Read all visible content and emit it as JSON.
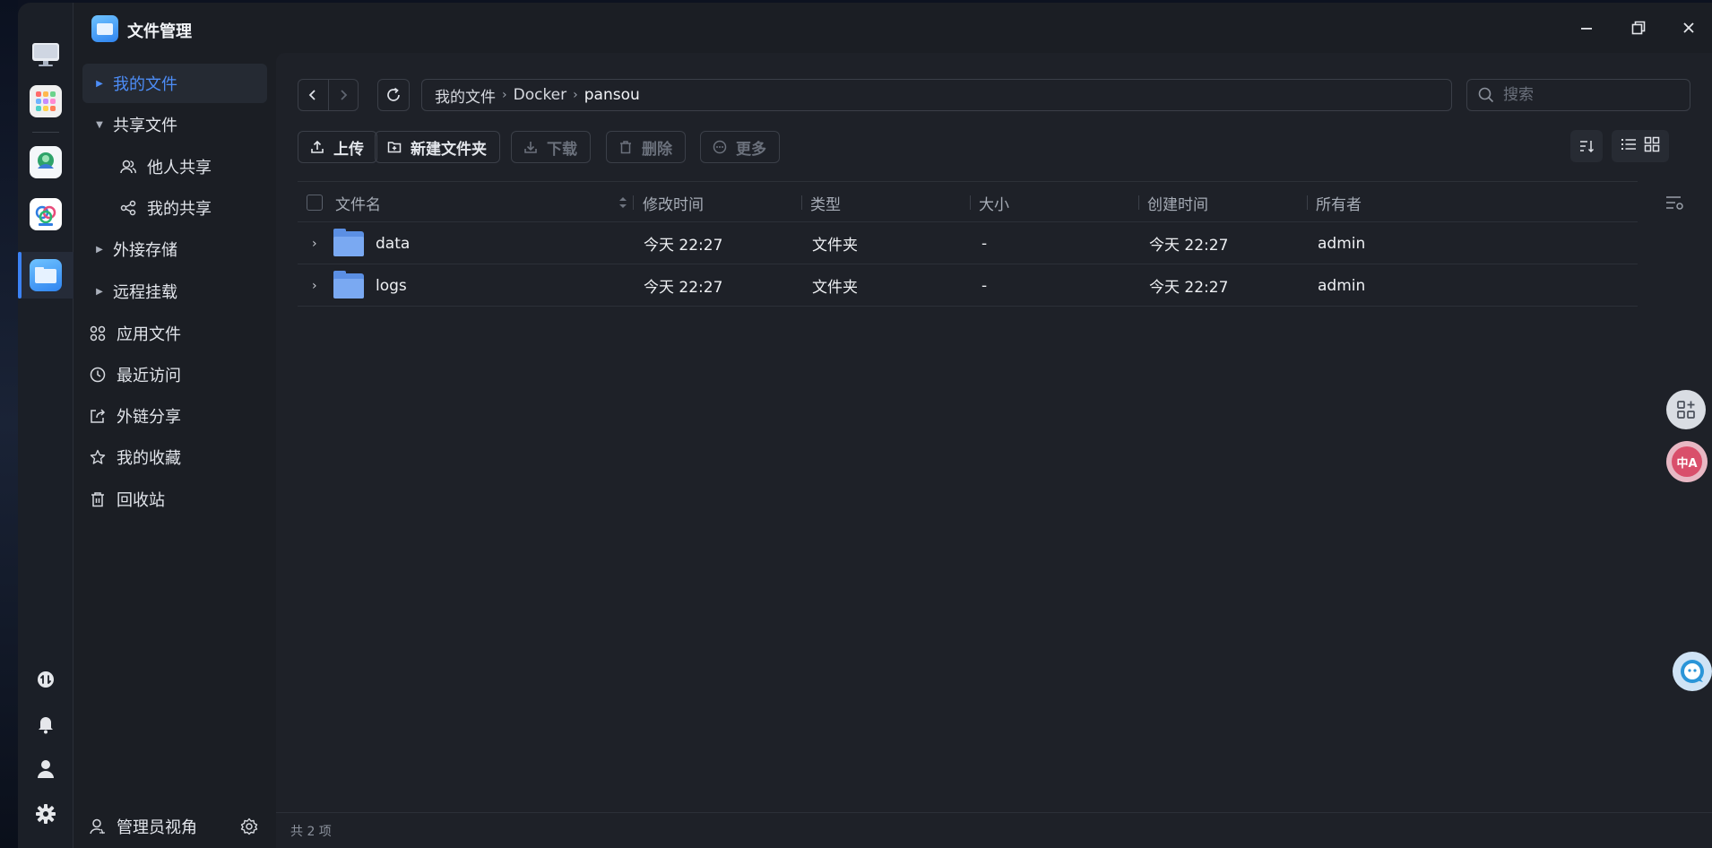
{
  "app": {
    "title": "文件管理"
  },
  "window_controls": {
    "minimize_icon": "minimize-icon",
    "maximize_icon": "maximize-icon",
    "close_icon": "close-icon"
  },
  "sidebar": {
    "items": [
      {
        "label": "我的文件",
        "icon": "caret-right",
        "active": true
      },
      {
        "label": "共享文件",
        "icon": "caret-down"
      },
      {
        "label": "他人共享",
        "icon": "users-icon"
      },
      {
        "label": "我的共享",
        "icon": "share-icon"
      },
      {
        "label": "外接存储",
        "icon": "caret-right"
      },
      {
        "label": "远程挂载",
        "icon": "caret-right"
      },
      {
        "label": "应用文件",
        "icon": "apps-icon"
      },
      {
        "label": "最近访问",
        "icon": "clock-icon"
      },
      {
        "label": "外链分享",
        "icon": "external-share-icon"
      },
      {
        "label": "我的收藏",
        "icon": "star-icon"
      },
      {
        "label": "回收站",
        "icon": "trash-icon"
      }
    ],
    "footer_label": "管理员视角"
  },
  "breadcrumb": {
    "items": [
      "我的文件",
      "Docker",
      "pansou"
    ]
  },
  "search": {
    "placeholder": "搜索"
  },
  "toolbar": {
    "upload": "上传",
    "new_folder": "新建文件夹",
    "download": "下载",
    "delete": "删除",
    "more": "更多"
  },
  "table": {
    "headers": [
      "文件名",
      "修改时间",
      "类型",
      "大小",
      "创建时间",
      "所有者"
    ],
    "rows": [
      {
        "name": "data",
        "modified": "今天 22:27",
        "type": "文件夹",
        "size": "-",
        "created": "今天 22:27",
        "owner": "admin"
      },
      {
        "name": "logs",
        "modified": "今天 22:27",
        "type": "文件夹",
        "size": "-",
        "created": "今天 22:27",
        "owner": "admin"
      }
    ]
  },
  "status": {
    "count_text": "共 2 项"
  },
  "colors": {
    "accent": "#4d8df7",
    "background": "#1e2128",
    "sidebar": "#1b1e24",
    "dock": "#1b1f27"
  }
}
